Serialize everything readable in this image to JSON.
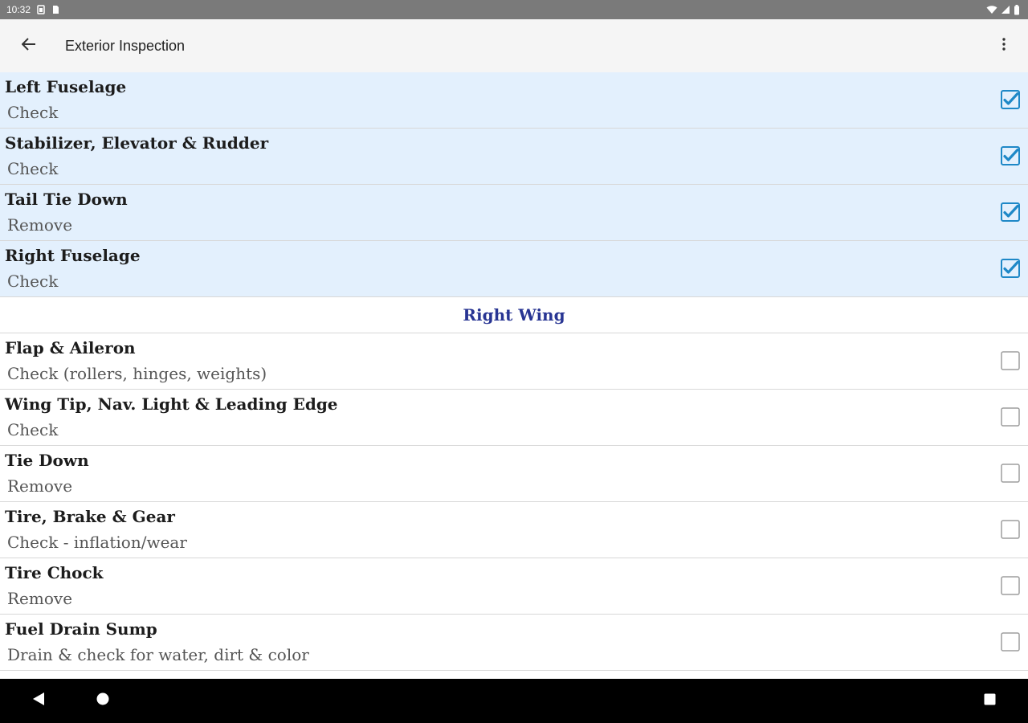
{
  "status_bar": {
    "time": "10:32"
  },
  "app_bar": {
    "title": "Exterior Inspection"
  },
  "items_top": [
    {
      "title": "Left Fuselage",
      "subtitle": "Check",
      "checked": true
    },
    {
      "title": "Stabilizer, Elevator & Rudder",
      "subtitle": "Check",
      "checked": true
    },
    {
      "title": "Tail Tie Down",
      "subtitle": "Remove",
      "checked": true
    },
    {
      "title": "Right Fuselage",
      "subtitle": "Check",
      "checked": true
    }
  ],
  "section": {
    "title": "Right Wing"
  },
  "items_bottom": [
    {
      "title": "Flap & Aileron",
      "subtitle": "Check (rollers, hinges, weights)",
      "checked": false
    },
    {
      "title": "Wing Tip, Nav. Light & Leading Edge",
      "subtitle": "Check",
      "checked": false
    },
    {
      "title": "Tie Down",
      "subtitle": "Remove",
      "checked": false
    },
    {
      "title": "Tire, Brake & Gear",
      "subtitle": "Check - inflation/wear",
      "checked": false
    },
    {
      "title": "Tire Chock",
      "subtitle": "Remove",
      "checked": false
    },
    {
      "title": "Fuel Drain Sump",
      "subtitle": "Drain & check for water, dirt & color",
      "checked": false
    }
  ],
  "colors": {
    "checked_row_bg": "#e3f0fd",
    "checkbox_checked": "#1e88c7",
    "section_title": "#283593"
  },
  "icons": {
    "back": "arrow-left-icon",
    "overflow": "more-vert-icon",
    "nav_back": "triangle-back-icon",
    "nav_home": "circle-home-icon",
    "nav_recents": "square-recents-icon"
  }
}
